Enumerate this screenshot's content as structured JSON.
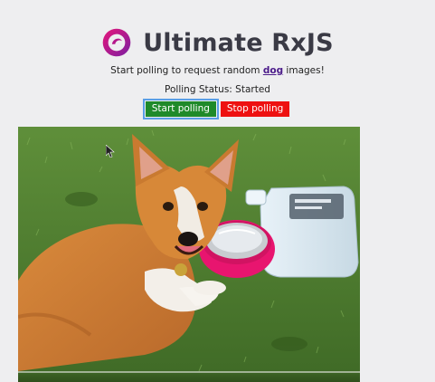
{
  "header": {
    "title": "Ultimate RxJS",
    "logo_icon": "rxjs-logo-icon",
    "accent": "#c2206e"
  },
  "intro": {
    "prefix": "Start polling to request random ",
    "link_text": "dog",
    "suffix": " images!"
  },
  "status": {
    "text": "Polling Status: Started"
  },
  "buttons": {
    "start_label": "Start polling",
    "stop_label": "Stop polling",
    "start_color": "#1f8a2a",
    "stop_color": "#ee1111"
  },
  "image": {
    "subject": "corgi-photo"
  }
}
